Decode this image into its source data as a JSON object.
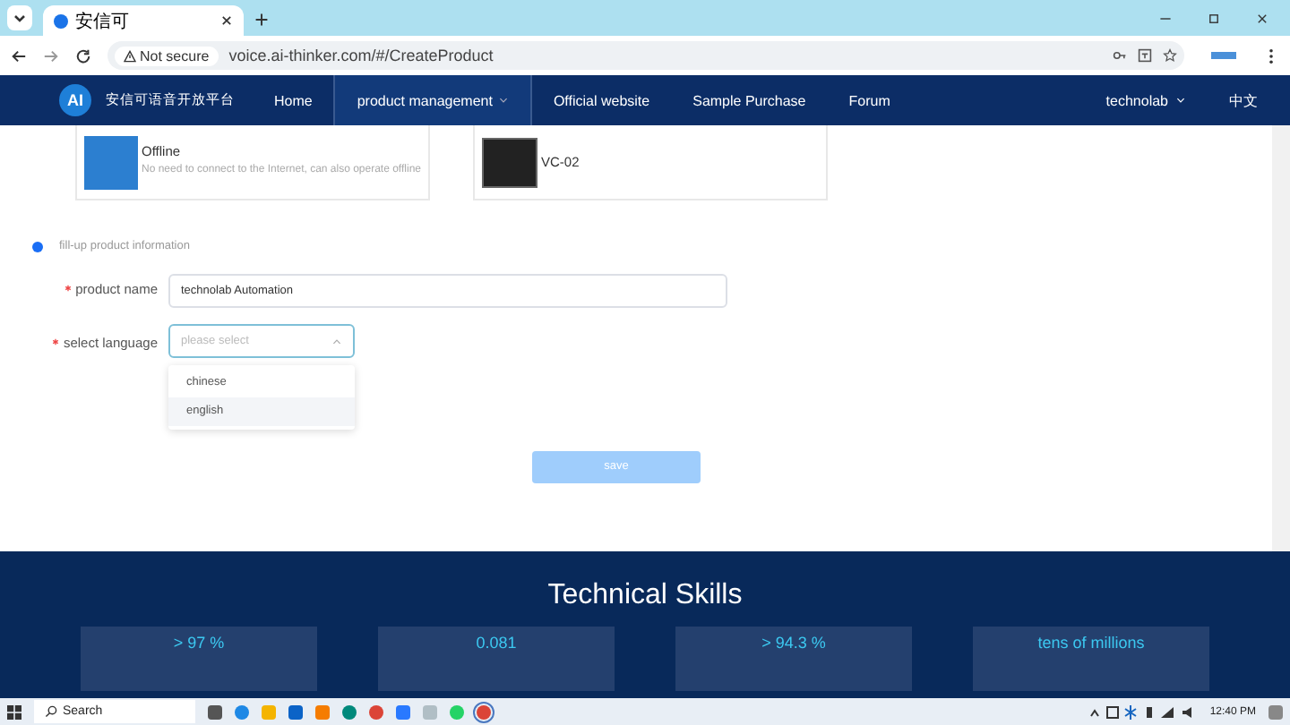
{
  "browser": {
    "tab_title": "安信可",
    "security": "Not secure",
    "url": "voice.ai-thinker.com/#/CreateProduct"
  },
  "nav": {
    "logo_text": "AI",
    "brand": "安信可语音开放平台",
    "items": [
      {
        "label": "Home",
        "selected": false,
        "dropdown": false
      },
      {
        "label": "product management",
        "selected": true,
        "dropdown": true
      },
      {
        "label": "Official website",
        "selected": false,
        "dropdown": false
      },
      {
        "label": "Sample Purchase",
        "selected": false,
        "dropdown": false
      },
      {
        "label": "Forum",
        "selected": false,
        "dropdown": false
      }
    ],
    "user": "technolab",
    "language": "中文"
  },
  "cards": [
    {
      "title": "Offline",
      "description": "No need to connect to the Internet, can also operate offline",
      "kind": "photo"
    },
    {
      "title": "VC-02",
      "kind": "chip"
    }
  ],
  "step": {
    "label": "fill-up product information"
  },
  "form": {
    "fields": [
      {
        "label": "product name",
        "required": true,
        "kind": "input",
        "value": "technolab Automation"
      },
      {
        "label": "select language",
        "required": true,
        "kind": "select",
        "placeholder": "please select",
        "expanded": true,
        "options": [
          {
            "label": "chinese",
            "selected": false
          },
          {
            "label": "english",
            "selected": true
          }
        ]
      }
    ],
    "save": "save"
  },
  "skills": {
    "title": "Technical Skills",
    "stats": [
      {
        "value": "> 97 %"
      },
      {
        "value": "0.081"
      },
      {
        "value": "> 94.3 %"
      },
      {
        "value": "tens of millions"
      }
    ]
  },
  "taskbar": {
    "search": "Search",
    "time": "12:40 PM"
  }
}
